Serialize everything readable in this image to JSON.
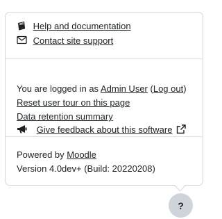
{
  "links": {
    "help_docs": "Help and documentation",
    "contact_support": "Contact site support"
  },
  "login": {
    "prefix": "You are logged in as ",
    "user": "Admin User",
    "open_paren": " (",
    "logout": "Log out",
    "close_paren": ")"
  },
  "actions": {
    "reset_tour": "Reset user tour on this page",
    "data_retention": "Data retention summary",
    "feedback": "Give feedback about this software"
  },
  "footer": {
    "powered_prefix": "Powered by ",
    "moodle": "Moodle",
    "version": "Version 4.0dev+ (Build: 20220208)"
  },
  "help_button": {
    "label": "?"
  },
  "icons": {
    "help": "book-icon",
    "contact": "envelope-icon",
    "feedback": "bullhorn-icon",
    "external": "external-link-icon"
  }
}
